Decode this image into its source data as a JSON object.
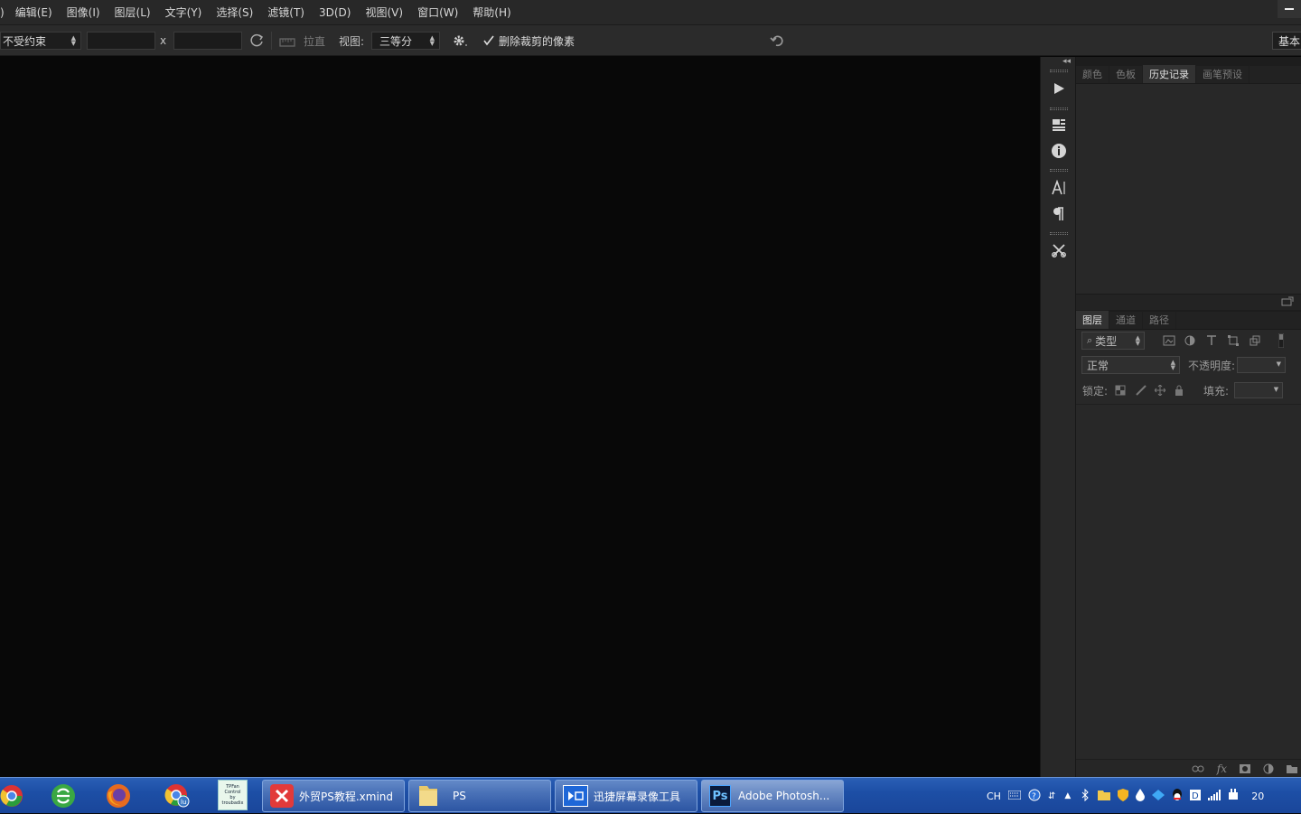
{
  "menubar": {
    "items": [
      ")",
      "编辑(E)",
      "图像(I)",
      "图层(L)",
      "文字(Y)",
      "选择(S)",
      "滤镜(T)",
      "3D(D)",
      "视图(V)",
      "窗口(W)",
      "帮助(H)"
    ]
  },
  "options": {
    "ratio_value": "不受约束",
    "x_label": "x",
    "straighten_label": "拉直",
    "view_label": "视图:",
    "view_value": "三等分",
    "delete_crop_label": "删除裁剪的像素",
    "delete_crop_checked": true,
    "workspace_label": "基本"
  },
  "top_panel": {
    "tabs": [
      "颜色",
      "色板",
      "历史记录",
      "画笔预设"
    ],
    "active_tab": "历史记录"
  },
  "layers_panel": {
    "tabs": [
      "图层",
      "通道",
      "路径"
    ],
    "active_tab": "图层",
    "filter_label": "类型",
    "blend_mode": "正常",
    "opacity_label": "不透明度:",
    "lock_label": "锁定:",
    "fill_label": "填充:"
  },
  "taskbar": {
    "quick_launch": [
      "chrome-icon",
      "browser-e-icon",
      "firefox-icon",
      "chrome-user-icon",
      "tpfan-icon"
    ],
    "tpfan_lines": [
      "TPFan",
      "Control",
      "by",
      "troubadix"
    ],
    "buttons": [
      {
        "label": "外贸PS教程.xmind",
        "icon": "xmind-icon",
        "active": false
      },
      {
        "label": "PS",
        "icon": "folder-icon",
        "active": false
      },
      {
        "label": "迅捷屏幕录像工具",
        "icon": "recorder-icon",
        "active": false
      },
      {
        "label": "Adobe Photosh...",
        "icon": "photoshop-icon",
        "active": true
      }
    ],
    "tray_lang": "CH",
    "clock_partial": "20"
  },
  "colors": {
    "menubar_bg": "#282828",
    "canvas_bg": "#080808",
    "panel_bg": "#282828",
    "taskbar_bg": "#1d4fa6"
  }
}
